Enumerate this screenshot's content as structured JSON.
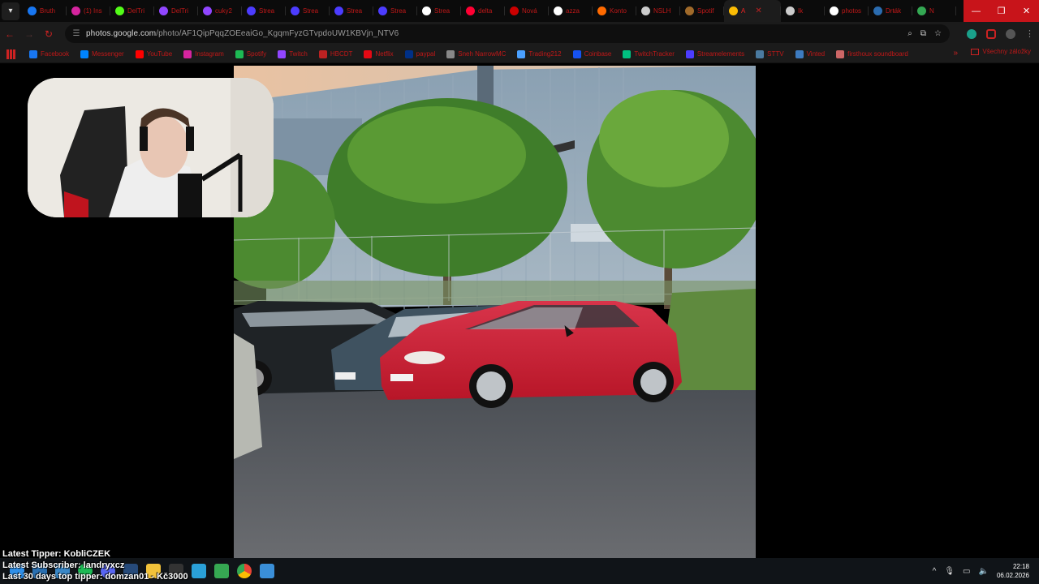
{
  "browser": {
    "tabs": [
      {
        "title": "Bruth",
        "icon": "messenger-icon",
        "color": "#1877f2"
      },
      {
        "title": "(1) Ins",
        "icon": "instagram-icon",
        "color": "#d6249f"
      },
      {
        "title": "DelTri",
        "icon": "kick-icon",
        "color": "#53fc18"
      },
      {
        "title": "DelTri",
        "icon": "twitch-icon",
        "color": "#9146ff"
      },
      {
        "title": "cuky2",
        "icon": "twitch-icon",
        "color": "#9146ff"
      },
      {
        "title": "Strea",
        "icon": "streamelements-icon",
        "color": "#4c3cff"
      },
      {
        "title": "Strea",
        "icon": "streamelements-icon",
        "color": "#4c3cff"
      },
      {
        "title": "Strea",
        "icon": "streamelements-icon",
        "color": "#4c3cff"
      },
      {
        "title": "Strea",
        "icon": "streamelements-icon",
        "color": "#4c3cff"
      },
      {
        "title": "Strea",
        "icon": "streamer-icon",
        "color": "#ffffff"
      },
      {
        "title": "delta",
        "icon": "youtube-icon",
        "color": "#ff0033"
      },
      {
        "title": "Nová",
        "icon": "opera-icon",
        "color": "#cc0000"
      },
      {
        "title": "azza",
        "icon": "google-icon",
        "color": "#ffffff"
      },
      {
        "title": "Konto",
        "icon": "kiwi-icon",
        "color": "#ff6a00"
      },
      {
        "title": "NSLH",
        "icon": "globe-icon",
        "color": "#cccccc"
      },
      {
        "title": "Spotif",
        "icon": "generic-icon",
        "color": "#a06a2a"
      },
      {
        "title": "A",
        "icon": "photos-icon",
        "color": "#fbbc04",
        "active": true
      },
      {
        "title": "Ik",
        "icon": "globe-icon",
        "color": "#cccccc"
      },
      {
        "title": "photos",
        "icon": "google-icon",
        "color": "#ffffff"
      },
      {
        "title": "Drŧák",
        "icon": "flag-icon",
        "color": "#2b6cb0"
      },
      {
        "title": "N",
        "icon": "photos-icon",
        "color": "#34a853"
      }
    ],
    "url_host": "photos.google.com",
    "url_path": "/photo/AF1QipPqqZOEeaiGo_KgqmFyzGTvpdoUW1KBVjn_NTV6",
    "bookmarks": [
      {
        "label": "Facebook",
        "color": "#1877f2"
      },
      {
        "label": "Messenger",
        "color": "#0084ff"
      },
      {
        "label": "YouTube",
        "color": "#ff0000"
      },
      {
        "label": "Instagram",
        "color": "#d6249f"
      },
      {
        "label": "Spotify",
        "color": "#1db954"
      },
      {
        "label": "Twitch",
        "color": "#9146ff"
      },
      {
        "label": "HBCDT",
        "color": "#bb2222"
      },
      {
        "label": "Netflix",
        "color": "#e50914"
      },
      {
        "label": "paypal",
        "color": "#003087"
      },
      {
        "label": "Sneh NarrowMC",
        "color": "#888888"
      },
      {
        "label": "Trading212",
        "color": "#4aa0ff"
      },
      {
        "label": "Coinbase",
        "color": "#1652f0"
      },
      {
        "label": "TwitchTracker",
        "color": "#00c080"
      },
      {
        "label": "Streamelements",
        "color": "#4c3cff"
      },
      {
        "label": "STTV",
        "color": "#4a7aa0"
      },
      {
        "label": "Vinted",
        "color": "#3d7bc0"
      },
      {
        "label": "firsthoux soundboard",
        "color": "#cc6666"
      }
    ],
    "all_bookmarks_label": "Všechny záložky"
  },
  "overlay": {
    "latest_tipper": "Latest Tipper: KobliCZEK",
    "latest_subscriber": "Latest Subscriber: landryxcz",
    "top_tipper": "Last 30 days top tipper: domzan01 - Kč3000"
  },
  "taskbar": {
    "time": "22:18",
    "date": "06.02.2026"
  }
}
